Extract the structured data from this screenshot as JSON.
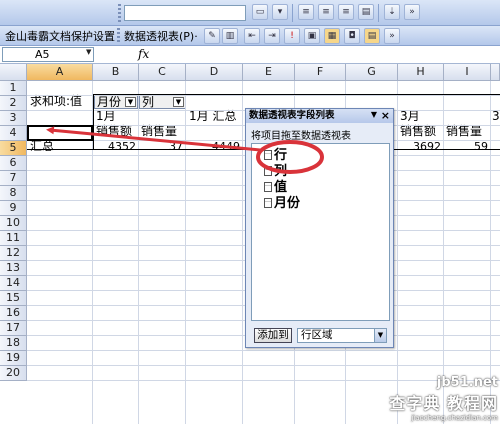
{
  "toolbar_top": {
    "font_combo_value": ""
  },
  "toolbar_second": {
    "jinshan_label": "金山毒霸文档保护设置",
    "pivot_label": "数据透视表(P)·"
  },
  "formula_bar": {
    "name_box": "A5",
    "fx": "fx",
    "value": ""
  },
  "grid": {
    "columns": [
      "A",
      "B",
      "C",
      "D",
      "E",
      "F",
      "G",
      "H",
      "I"
    ],
    "rows": [
      "1",
      "2",
      "3",
      "4",
      "5",
      "6",
      "7",
      "8",
      "9",
      "10",
      "11",
      "12",
      "13",
      "14",
      "15",
      "16",
      "17",
      "18",
      "19",
      "20"
    ],
    "selected_col": "A",
    "selected_row": "5",
    "cells": {
      "a3": "求和项:值",
      "b3_field": "月份",
      "c3_field": "列",
      "b4": "1月",
      "d4": "1月 汇总",
      "h4": "3月",
      "b5": "销售额",
      "c5": "销售量",
      "h5": "销售额",
      "i5": "销售量",
      "a6": "汇总",
      "b6": "4352",
      "c6": "37",
      "d6": "4449",
      "h6": "3692",
      "i6": "59",
      "j4_partial": "3"
    }
  },
  "pivot_panel": {
    "title": "数据透视表字段列表",
    "hint": "将项目拖至数据透视表",
    "fields": [
      "行",
      "列",
      "值",
      "月份"
    ],
    "add_button": "添加到",
    "area_value": "行区域"
  },
  "colors": {
    "annotation": "#d9333a",
    "toolbar_light": "#dbe6f7",
    "toolbar_dark": "#b4c8ea",
    "selection": "#f0b860"
  },
  "watermark": {
    "line1": "jb51.net",
    "line2": "查字典 教程网",
    "line3": "jiaocheng.chazidian.com"
  }
}
